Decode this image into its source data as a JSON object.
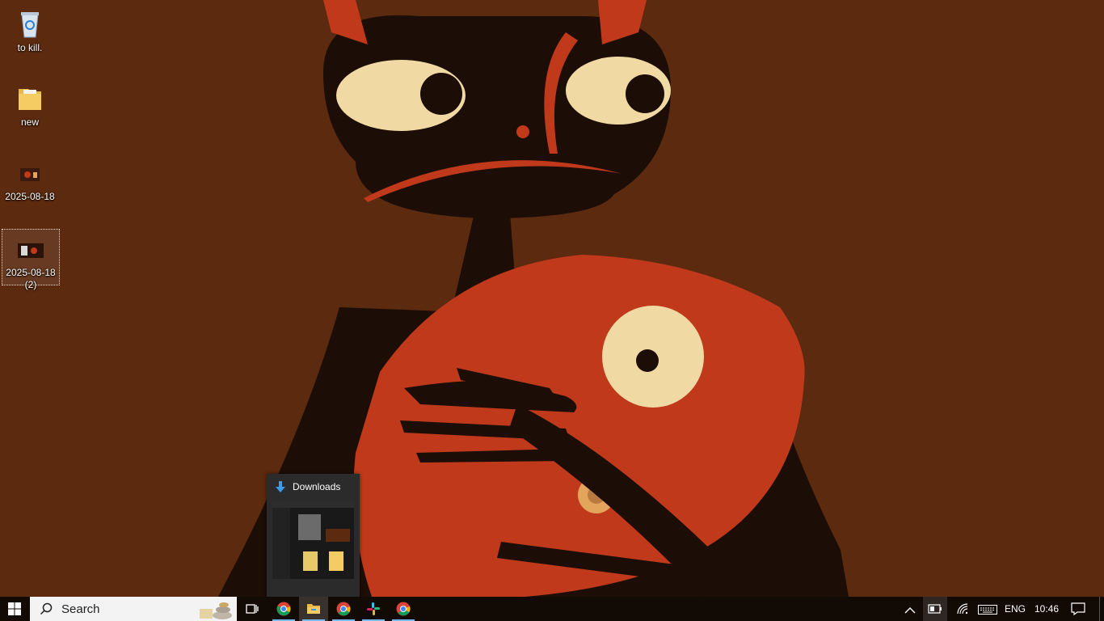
{
  "desktop": {
    "icons": [
      {
        "label": "to kill.",
        "icon": "recycle-bin-icon"
      },
      {
        "label": "new",
        "icon": "folder-icon"
      },
      {
        "label": "2025-08-18",
        "icon": "image-file-icon"
      },
      {
        "label": "2025-08-18 (2)",
        "icon": "image-file-icon"
      }
    ]
  },
  "thumbnail_popup": {
    "title": "Downloads",
    "icon": "download-arrow-icon"
  },
  "taskbar": {
    "search_placeholder": "Search",
    "apps": [
      {
        "name": "Google Chrome",
        "icon": "chrome-icon",
        "running": true
      },
      {
        "name": "File Explorer",
        "icon": "file-explorer-icon",
        "running": true,
        "active": true
      },
      {
        "name": "Google Chrome",
        "icon": "chrome-icon",
        "running": true
      },
      {
        "name": "Slack",
        "icon": "slack-icon",
        "running": true
      },
      {
        "name": "Google Chrome",
        "icon": "chrome-icon",
        "running": true
      }
    ],
    "tray": {
      "language": "ENG",
      "time": "10:46"
    }
  },
  "colors": {
    "wallpaper_bg": "#5c2a0f",
    "taskbar_bg": "#120a05",
    "accent_underline": "#76b9ed",
    "wallpaper_red": "#c0391b",
    "wallpaper_cream": "#f0d9a2",
    "wallpaper_dark": "#1c0d07"
  }
}
